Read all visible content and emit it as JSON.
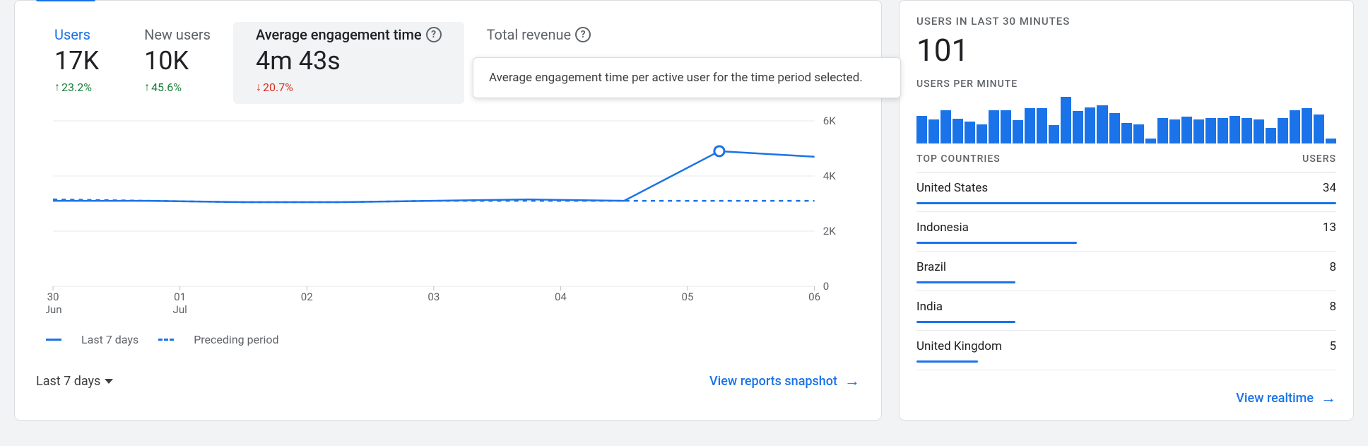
{
  "left": {
    "tabs": [
      {
        "label": "Users",
        "value": "17K",
        "change": "23.2%",
        "dir": "up",
        "label_style": "blue"
      },
      {
        "label": "New users",
        "value": "10K",
        "change": "45.6%",
        "dir": "up",
        "label_style": "grey"
      },
      {
        "label": "Average engagement time",
        "value": "4m 43s",
        "change": "20.7%",
        "dir": "down",
        "label_style": "dark",
        "help": true,
        "selected": true
      },
      {
        "label": "Total revenue",
        "value": "",
        "change": "",
        "dir": "",
        "label_style": "grey",
        "help": true
      }
    ],
    "tooltip": "Average engagement time per active user for the time period selected.",
    "legend": [
      "Last 7 days",
      "Preceding period"
    ],
    "range_selector": "Last 7 days",
    "link": "View reports snapshot"
  },
  "right": {
    "h1": "USERS IN LAST 30 MINUTES",
    "big": "101",
    "sub": "USERS PER MINUTE",
    "table_head": [
      "TOP COUNTRIES",
      "USERS"
    ],
    "countries": [
      {
        "name": "United States",
        "users": 34
      },
      {
        "name": "Indonesia",
        "users": 13
      },
      {
        "name": "Brazil",
        "users": 8
      },
      {
        "name": "India",
        "users": 8
      },
      {
        "name": "United Kingdom",
        "users": 5
      }
    ],
    "link": "View realtime"
  },
  "chart_data": {
    "main": {
      "type": "line",
      "xlabel": "",
      "ylabel": "",
      "ylim": [
        0,
        6000
      ],
      "y_ticks": [
        0,
        2000,
        4000,
        6000
      ],
      "y_tick_labels": [
        "0",
        "2K",
        "4K",
        "6K"
      ],
      "x_ticks": [
        "30 Jun",
        "01 Jul",
        "02",
        "03",
        "04",
        "05",
        "06"
      ],
      "series": [
        {
          "name": "Last 7 days",
          "style": "solid",
          "values": [
            3100,
            3100,
            3050,
            3050,
            3100,
            3150,
            3100,
            4900,
            4700
          ]
        },
        {
          "name": "Preceding period",
          "style": "dash",
          "values": [
            3150,
            3100,
            3050,
            3050,
            3100,
            3100,
            3100,
            3100,
            3100
          ]
        }
      ],
      "marker": {
        "series": 0,
        "index": 7,
        "value": 4900
      }
    },
    "users_per_minute": {
      "type": "bar",
      "values": [
        46,
        40,
        55,
        41,
        36,
        32,
        55,
        55,
        38,
        58,
        58,
        30,
        77,
        54,
        60,
        63,
        50,
        34,
        32,
        8,
        42,
        40,
        44,
        40,
        42,
        42,
        46,
        42,
        40,
        26,
        42,
        55,
        58,
        48,
        8
      ]
    }
  }
}
